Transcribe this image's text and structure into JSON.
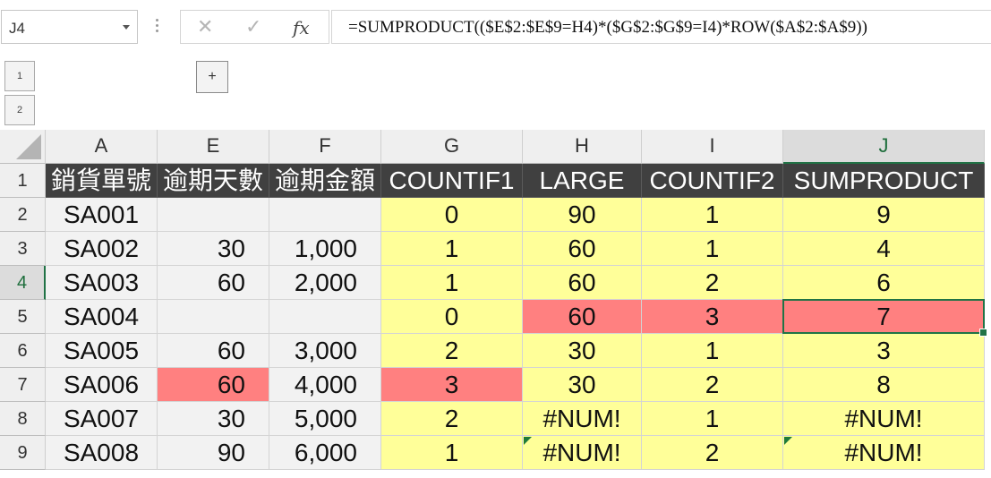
{
  "formula_bar": {
    "name_box": "J4",
    "cancel_icon": "✕",
    "enter_icon": "✓",
    "fx_label": "fx",
    "formula": "=SUMPRODUCT(($E$2:$E$9=H4)*($G$2:$G$9=I4)*ROW($A$2:$A$9))"
  },
  "outline": {
    "levels": [
      "1",
      "2"
    ],
    "expand_label": "+"
  },
  "columns": [
    "A",
    "E",
    "F",
    "G",
    "H",
    "I",
    "J"
  ],
  "active_column": "J",
  "rows": [
    "1",
    "2",
    "3",
    "4",
    "5",
    "6",
    "7",
    "8",
    "9"
  ],
  "active_row": "4",
  "headers": [
    "銷貨單號",
    "逾期天數",
    "逾期金額",
    "COUNTIF1",
    "LARGE",
    "COUNTIF2",
    "SUMPRODUCT"
  ],
  "data": [
    [
      "SA001",
      "",
      "",
      "0",
      "90",
      "1",
      "9"
    ],
    [
      "SA002",
      "30",
      "1,000",
      "1",
      "60",
      "1",
      "4"
    ],
    [
      "SA003",
      "60",
      "2,000",
      "1",
      "60",
      "2",
      "6"
    ],
    [
      "SA004",
      "",
      "",
      "0",
      "60",
      "3",
      "7"
    ],
    [
      "SA005",
      "60",
      "3,000",
      "2",
      "30",
      "1",
      "3"
    ],
    [
      "SA006",
      "60",
      "4,000",
      "3",
      "30",
      "2",
      "8"
    ],
    [
      "SA007",
      "30",
      "5,000",
      "2",
      "#NUM!",
      "1",
      "#NUM!"
    ],
    [
      "SA008",
      "90",
      "6,000",
      "1",
      "#NUM!",
      "2",
      "#NUM!"
    ]
  ],
  "colors": {
    "header_bg": "#404040",
    "input_bg": "#f2f2f2",
    "calc_bg": "#ffff99",
    "highlight": "#ff8080",
    "select": "#217346"
  },
  "highlights": [
    [
      3,
      4
    ],
    [
      3,
      5
    ],
    [
      3,
      6
    ],
    [
      5,
      1
    ],
    [
      5,
      3
    ]
  ],
  "error_flags": [
    [
      7,
      4
    ],
    [
      7,
      6
    ],
    [
      8,
      4
    ],
    [
      8,
      6
    ]
  ],
  "selected_cell": [
    3,
    6
  ]
}
